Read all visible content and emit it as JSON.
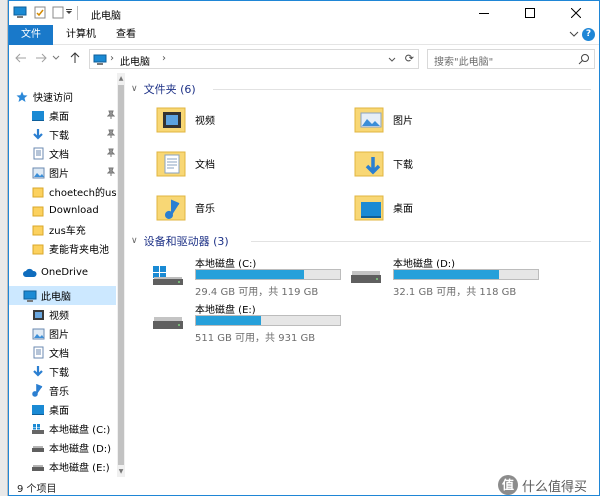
{
  "window": {
    "title": "此电脑"
  },
  "ribbon": {
    "tabs": [
      {
        "label": "文件"
      },
      {
        "label": "计算机"
      },
      {
        "label": "查看"
      }
    ]
  },
  "address": {
    "path": [
      "此电脑"
    ],
    "search_placeholder": "搜索\"此电脑\""
  },
  "nav": {
    "quick_access": "快速访问",
    "pinned": [
      {
        "label": "桌面",
        "icon": "desktop-icon"
      },
      {
        "label": "下载",
        "icon": "download-icon"
      },
      {
        "label": "文档",
        "icon": "documents-icon"
      },
      {
        "label": "图片",
        "icon": "pictures-icon"
      }
    ],
    "folders": [
      "choetech的usb",
      "Download",
      "zus车充",
      "麦能背夹电池"
    ],
    "onedrive": "OneDrive",
    "this_pc": "此电脑",
    "pc_children": [
      {
        "label": "视频",
        "icon": "videos-icon"
      },
      {
        "label": "图片",
        "icon": "pictures-icon"
      },
      {
        "label": "文档",
        "icon": "documents-icon"
      },
      {
        "label": "下载",
        "icon": "download-icon"
      },
      {
        "label": "音乐",
        "icon": "music-icon"
      },
      {
        "label": "桌面",
        "icon": "desktop-icon"
      },
      {
        "label": "本地磁盘 (C:)",
        "icon": "windows-drive-icon"
      },
      {
        "label": "本地磁盘 (D:)",
        "icon": "drive-icon"
      },
      {
        "label": "本地磁盘 (E:)",
        "icon": "drive-icon"
      }
    ]
  },
  "content": {
    "folders_header": "文件夹 (6)",
    "folders": [
      {
        "label": "视频",
        "icon": "videos-folder-icon"
      },
      {
        "label": "图片",
        "icon": "pictures-folder-icon"
      },
      {
        "label": "文档",
        "icon": "documents-folder-icon"
      },
      {
        "label": "下载",
        "icon": "downloads-folder-icon"
      },
      {
        "label": "音乐",
        "icon": "music-folder-icon"
      },
      {
        "label": "桌面",
        "icon": "desktop-folder-icon"
      }
    ],
    "devices_header": "设备和驱动器 (3)",
    "drives": [
      {
        "name": "本地磁盘 (C:)",
        "size": "29.4 GB 可用，共 119 GB",
        "used_fraction": 0.753,
        "icon": "windows-drive-icon"
      },
      {
        "name": "本地磁盘 (D:)",
        "size": "32.1 GB 可用，共 118 GB",
        "used_fraction": 0.728,
        "icon": "drive-icon"
      },
      {
        "name": "本地磁盘 (E:)",
        "size": "511 GB 可用，共 931 GB",
        "used_fraction": 0.451,
        "icon": "drive-icon"
      }
    ]
  },
  "status": {
    "items": "9 个项目"
  },
  "watermark": {
    "badge": "值",
    "text": "什么值得买"
  },
  "colors": {
    "accent": "#1979ca",
    "bar_fill": "#26a0da",
    "header_text": "#1e3287",
    "selected_bg": "#cce8ff"
  }
}
